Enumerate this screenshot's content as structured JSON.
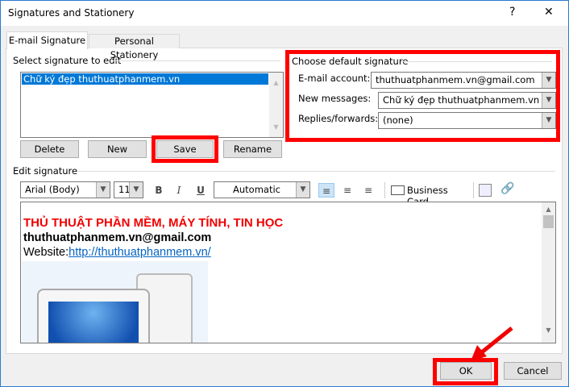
{
  "window": {
    "title": "Signatures and Stationery",
    "help": "?",
    "close": "✕"
  },
  "tabs": [
    {
      "label": "E-mail Signature"
    },
    {
      "label": "Personal Stationery"
    }
  ],
  "select_section": {
    "label": "Select signature to edit",
    "items": [
      "Chữ ký đẹp thuthuatphanmem.vn"
    ]
  },
  "buttons": {
    "delete": "Delete",
    "new": "New",
    "save": "Save",
    "rename": "Rename",
    "ok": "OK",
    "cancel": "Cancel"
  },
  "defaults": {
    "label": "Choose default signature",
    "email_label": "E-mail account:",
    "email_value": "thuthuatphanmem.vn@gmail.com",
    "new_label": "New messages:",
    "new_value": "Chữ ký đẹp thuthuatphanmem.vn",
    "reply_label": "Replies/forwards:",
    "reply_value": "(none)"
  },
  "editor": {
    "label": "Edit signature",
    "font": "Arial (Body)",
    "size": "11",
    "bold": "B",
    "italic": "I",
    "underline": "U",
    "color": "Automatic",
    "business_card": "Business Card",
    "heading": "THỦ THUẬT PHẦN MỀM, MÁY TÍNH, TIN HỌC",
    "email": "thuthuatphanmem.vn@gmail.com",
    "website_label": "Website:",
    "website_url": "http://thuthuatphanmem.vn/"
  },
  "colors": {
    "highlight": "#f00000",
    "selection": "#0078d7",
    "link": "#0563c1"
  }
}
